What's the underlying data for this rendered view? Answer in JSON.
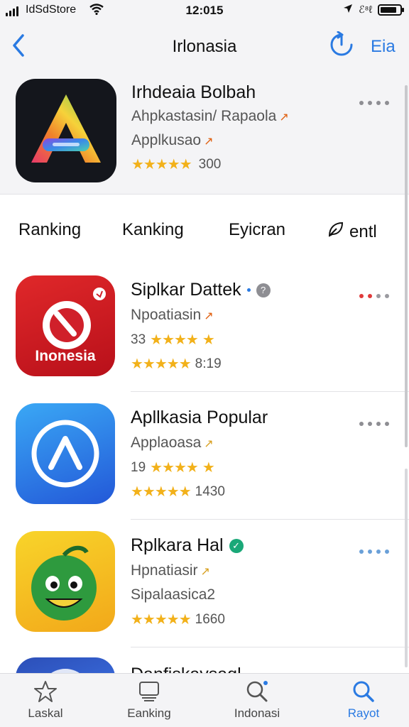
{
  "status_bar": {
    "carrier": "IdSdStore",
    "time": "12:015",
    "right_glyphs": "ℰ⁸ℓ"
  },
  "nav": {
    "title": "Irlonasia",
    "right_label": "Eia"
  },
  "featured": {
    "title": "Irhdeaia Bolbah",
    "subtitle1": "Ahpkastasin/ Rapaola",
    "subtitle2": "Applkusao",
    "stars": "★★★★★",
    "rating": "300"
  },
  "tabs": [
    {
      "label": "Ranking"
    },
    {
      "label": "Kanking"
    },
    {
      "label": "Eyicran"
    },
    {
      "label": "entl"
    }
  ],
  "apps": [
    {
      "title": "Siplkar Dattek",
      "icon_text": "Inonesia",
      "subtitle": "Npoatiasin",
      "line3_num": "33",
      "line3_stars": "★★★★",
      "line4_stars": "★★★★★",
      "line4_num": "8:19",
      "accent": "#d0202a"
    },
    {
      "title": "Apllkasia Popular",
      "subtitle": "Applaoasa",
      "line3_num": "19",
      "line3_stars": "★★★★",
      "line4_stars": "★★★★★",
      "line4_num": "1430",
      "accent": "#2a7ae2"
    },
    {
      "title": "Rplkara Hal",
      "subtitle": "Hpnatiasir",
      "line3_text": "Sipalaasica2",
      "line4_stars": "★★★★★",
      "line4_num": "1660",
      "accent": "#f2c21a"
    }
  ],
  "partial": {
    "title": "Danfiskaysaql"
  },
  "tab_bar": {
    "items": [
      {
        "label": "Laskal",
        "icon": "star-outline-icon"
      },
      {
        "label": "Eanking",
        "icon": "stack-icon"
      },
      {
        "label": "Indonasi",
        "icon": "search-icon"
      },
      {
        "label": "Rayot",
        "icon": "search-icon"
      }
    ]
  }
}
